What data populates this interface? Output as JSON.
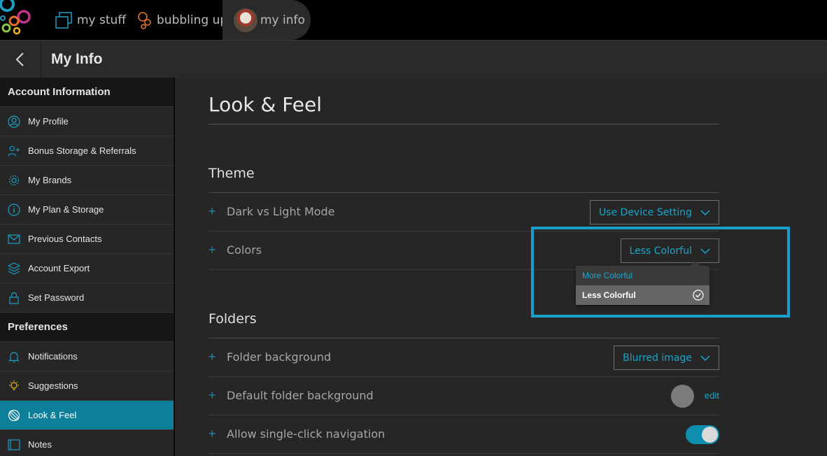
{
  "topbar": {
    "tabs": [
      {
        "label": "my stuff",
        "icon": "folders-icon"
      },
      {
        "label": "bubbling up",
        "icon": "bubbles-icon"
      },
      {
        "label": "my info",
        "icon": "avatar"
      }
    ]
  },
  "header": {
    "title": "My Info"
  },
  "sidebar": {
    "sections": [
      {
        "title": "Account Information",
        "items": [
          {
            "label": "My Profile",
            "icon": "profile-icon"
          },
          {
            "label": "Bonus Storage & Referrals",
            "icon": "add-user-icon"
          },
          {
            "label": "My Brands",
            "icon": "gear-icon"
          },
          {
            "label": "My Plan & Storage",
            "icon": "info-icon"
          },
          {
            "label": "Previous Contacts",
            "icon": "envelope-icon"
          },
          {
            "label": "Account Export",
            "icon": "export-icon"
          },
          {
            "label": "Set Password",
            "icon": "lock-icon"
          }
        ]
      },
      {
        "title": "Preferences",
        "items": [
          {
            "label": "Notifications",
            "icon": "bell-icon"
          },
          {
            "label": "Suggestions",
            "icon": "lightbulb-icon"
          },
          {
            "label": "Look & Feel",
            "icon": "palette-icon",
            "active": true
          },
          {
            "label": "Notes",
            "icon": "notes-icon"
          }
        ]
      }
    ]
  },
  "main": {
    "title": "Look & Feel",
    "theme": {
      "heading": "Theme",
      "dark_light": {
        "label": "Dark vs Light Mode",
        "value": "Use Device Setting"
      },
      "colors": {
        "label": "Colors",
        "value": "Less Colorful"
      }
    },
    "colors_popup": {
      "options": [
        "More Colorful",
        "Less Colorful"
      ],
      "selected": "Less Colorful"
    },
    "folders": {
      "heading": "Folders",
      "folder_background": {
        "label": "Folder background",
        "value": "Blurred image"
      },
      "default_background": {
        "label": "Default folder background",
        "edit": "edit"
      },
      "single_click": {
        "label": "Allow single-click navigation",
        "enabled": true
      }
    }
  },
  "colors": {
    "accent": "#18a7cc",
    "active_nav": "#0e7f99",
    "highlight": "#1aa0c8"
  }
}
